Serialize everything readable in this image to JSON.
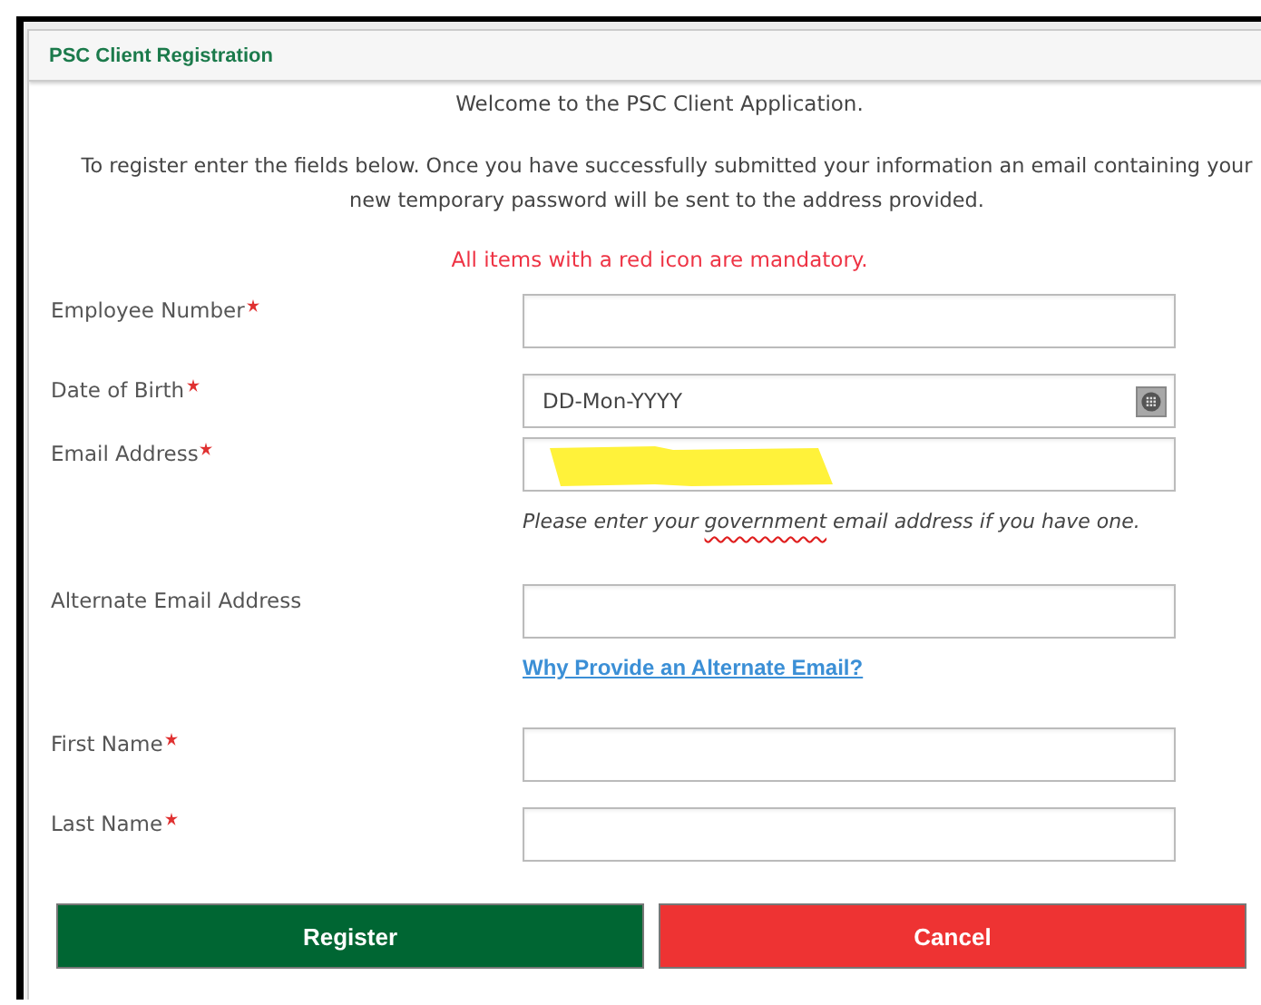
{
  "panel": {
    "title": "PSC Client Registration"
  },
  "welcome": "Welcome to the PSC Client Application.",
  "intro": "To register enter the fields below. Once you have successfully submitted your information an email containing your new temporary password will be sent to the address provided.",
  "mandatory_note": "All items with a red icon are mandatory.",
  "fields": [
    {
      "kind": "text",
      "label": "Employee Number",
      "required": true
    },
    {
      "kind": "date",
      "label": "Date of Birth",
      "required": true,
      "placeholder": "DD-Mon-YYYY"
    },
    {
      "kind": "text",
      "label": "Email Address",
      "required": true,
      "redacted": true,
      "hint": {
        "before": "Please enter your ",
        "flagged_word": "government",
        "after": " email address if you have one."
      }
    },
    {
      "kind": "text",
      "label": "Alternate Email Address",
      "required": false,
      "link": "Why Provide an Alternate Email?"
    },
    {
      "kind": "text",
      "label": "First Name",
      "required": true
    },
    {
      "kind": "text",
      "label": "Last Name",
      "required": true
    }
  ],
  "buttons": [
    {
      "label": "Register",
      "kind": "primary"
    },
    {
      "label": "Cancel",
      "kind": "danger"
    }
  ]
}
